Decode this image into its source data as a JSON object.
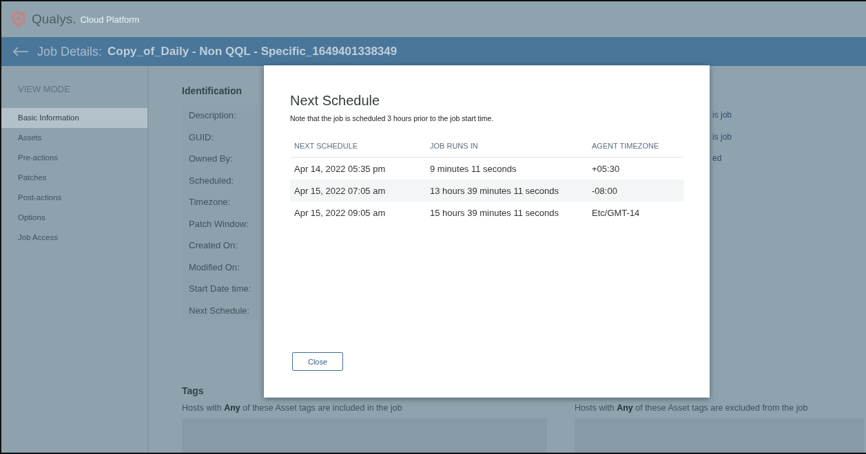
{
  "app": {
    "logo": "Qualys.",
    "logo_sub": "Cloud Platform"
  },
  "page_header": {
    "label": "Job Details:",
    "job_name": "Copy_of_Daily - Non QQL - Specific_1649401338349"
  },
  "sidebar": {
    "heading": "VIEW MODE",
    "items": [
      {
        "label": "Basic Information",
        "selected": true
      },
      {
        "label": "Assets",
        "selected": false
      },
      {
        "label": "Pre-actions",
        "selected": false
      },
      {
        "label": "Patches",
        "selected": false
      },
      {
        "label": "Post-actions",
        "selected": false
      },
      {
        "label": "Options",
        "selected": false
      },
      {
        "label": "Job Access",
        "selected": false
      }
    ]
  },
  "identification": {
    "title": "Identification",
    "fields": [
      "Description:",
      "GUID:",
      "Owned By:",
      "Scheduled:",
      "Timezone:",
      "Patch Window:",
      "Created On:",
      "Modified On:",
      "Start Date time:",
      "Next Schedule:"
    ]
  },
  "right_column_fragments": [
    "is job",
    "is job",
    "ed"
  ],
  "tags": {
    "title": "Tags",
    "included_note": "Hosts with **Any** of these Asset tags are included in the job",
    "excluded_note": "Hosts with **Any** of these Asset tags are excluded from the job"
  },
  "modal": {
    "title": "Next Schedule",
    "note": "Note that the job is scheduled 3 hours prior to the job start time.",
    "columns": [
      "NEXT SCHEDULE",
      "JOB RUNS IN",
      "AGENT TIMEZONE"
    ],
    "rows": [
      {
        "cells": [
          "Apr 14, 2022 05:35 pm",
          "9 minutes 11 seconds",
          "+05:30"
        ]
      },
      {
        "cells": [
          "Apr 15, 2022 07:05 am",
          "13 hours 39 minutes 11 seconds",
          "-08:00"
        ]
      },
      {
        "cells": [
          "Apr 15, 2022 09:05 am",
          "15 hours 39 minutes 11 seconds",
          "Etc/GMT-14"
        ]
      }
    ],
    "close_button": "Close"
  }
}
